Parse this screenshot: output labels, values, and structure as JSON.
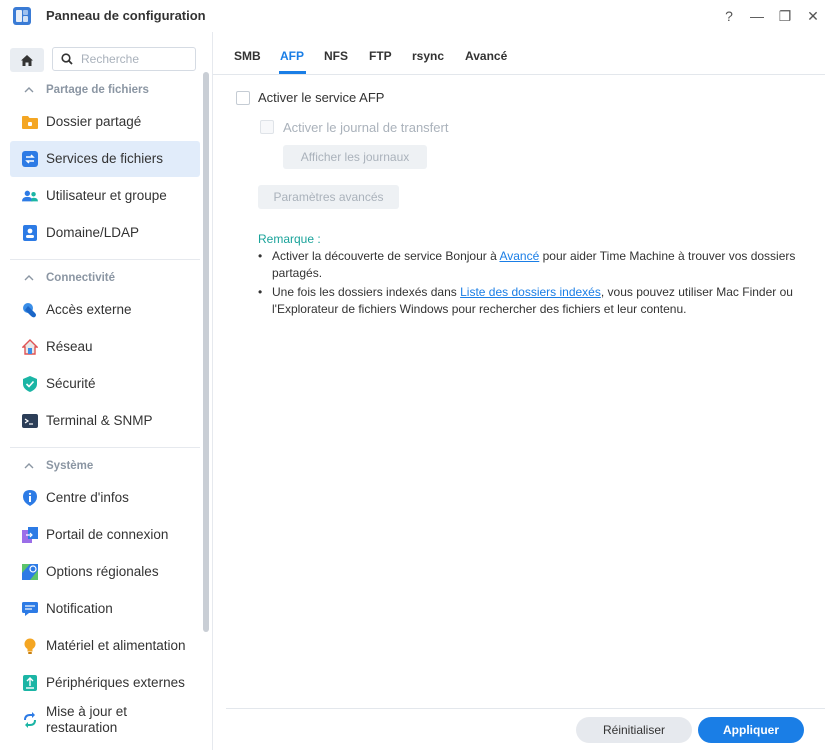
{
  "window": {
    "title": "Panneau de configuration",
    "controls": {
      "help": "?",
      "minimize": "—",
      "restore": "❐",
      "close": "✕"
    }
  },
  "sidebar": {
    "search_placeholder": "Recherche",
    "sections": [
      {
        "label": "Partage de fichiers",
        "items": [
          {
            "label": "Dossier partagé",
            "icon": "folder-icon"
          },
          {
            "label": "Services de fichiers",
            "icon": "file-services-icon",
            "selected": true
          },
          {
            "label": "Utilisateur et groupe",
            "icon": "users-icon"
          },
          {
            "label": "Domaine/LDAP",
            "icon": "domain-icon"
          }
        ]
      },
      {
        "label": "Connectivité",
        "items": [
          {
            "label": "Accès externe",
            "icon": "external-access-icon"
          },
          {
            "label": "Réseau",
            "icon": "network-icon"
          },
          {
            "label": "Sécurité",
            "icon": "security-icon"
          },
          {
            "label": "Terminal & SNMP",
            "icon": "terminal-icon"
          }
        ]
      },
      {
        "label": "Système",
        "items": [
          {
            "label": "Centre d'infos",
            "icon": "info-icon"
          },
          {
            "label": "Portail de connexion",
            "icon": "portal-icon"
          },
          {
            "label": "Options régionales",
            "icon": "regional-icon"
          },
          {
            "label": "Notification",
            "icon": "notification-icon"
          },
          {
            "label": "Matériel et alimentation",
            "icon": "hardware-icon"
          },
          {
            "label": "Périphériques externes",
            "icon": "external-devices-icon"
          },
          {
            "label": "Mise à jour et restauration",
            "icon": "update-icon"
          }
        ]
      }
    ]
  },
  "tabs": [
    {
      "label": "SMB"
    },
    {
      "label": "AFP",
      "active": true
    },
    {
      "label": "NFS"
    },
    {
      "label": "FTP"
    },
    {
      "label": "rsync"
    },
    {
      "label": "Avancé"
    }
  ],
  "afp": {
    "enable_label": "Activer le service AFP",
    "enable_checked": false,
    "log_label": "Activer le journal de transfert",
    "view_logs_button": "Afficher les journaux",
    "advanced_button": "Paramètres avancés",
    "note_title": "Remarque :",
    "note1": {
      "before": "Activer la découverte de service Bonjour à ",
      "link": "Avancé",
      "after": " pour aider Time Machine à trouver vos dossiers partagés."
    },
    "note2": {
      "before": "Une fois les dossiers indexés dans ",
      "link": "Liste des dossiers indexés",
      "after": ", vous pouvez utiliser Mac Finder ou l'Explorateur de fichiers Windows pour rechercher des fichiers et leur contenu."
    },
    "bullet": "•"
  },
  "footer": {
    "reset": "Réinitialiser",
    "apply": "Appliquer"
  },
  "colors": {
    "accent": "#1a7ee6",
    "note_title": "#1aa39a",
    "selected_bg": "#e1ecfa"
  }
}
